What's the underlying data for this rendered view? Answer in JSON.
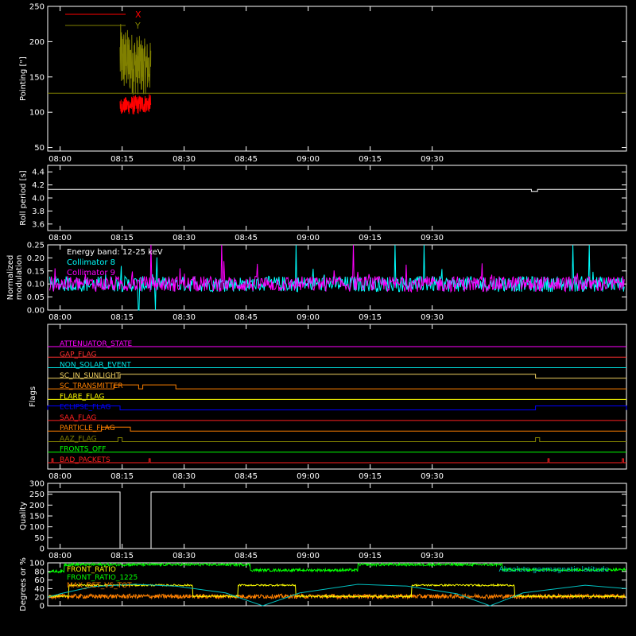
{
  "chart_data": [
    {
      "type": "line",
      "ylabel": "Pointing [\"]",
      "ylim": [
        45,
        250
      ],
      "yticks": [
        50,
        100,
        150,
        200,
        250
      ],
      "xticks": [
        "08:00",
        "08:15",
        "08:30",
        "08:45",
        "09:00",
        "09:15",
        "09:30"
      ],
      "xlim_minutes": [
        -3,
        137
      ],
      "legend": "top-left",
      "series": [
        {
          "name": "X",
          "color": "#ff0000",
          "band": [
            [
              14.5,
              98,
              120
            ],
            [
              18,
              96,
              124
            ],
            [
              22,
              100,
              126
            ]
          ],
          "range_minutes": [
            14.5,
            22
          ]
        },
        {
          "name": "Y",
          "color": "#808000",
          "band": [
            [
              14.5,
              128,
              226
            ],
            [
              18,
              124,
              212
            ],
            [
              22,
              126,
              200
            ]
          ],
          "range_minutes": [
            14.5,
            22
          ]
        }
      ],
      "reference_line": {
        "y": 127,
        "color": "#808000"
      }
    },
    {
      "type": "line",
      "ylabel": "Roll period [s]",
      "ylim": [
        3.5,
        4.5
      ],
      "yticks": [
        "4.4",
        "4.2",
        "4.0",
        "3.8",
        "3.6"
      ],
      "ytick_values": [
        4.4,
        4.2,
        4.0,
        3.8,
        3.6
      ],
      "xticks": [
        "08:00",
        "08:15",
        "08:30",
        "08:45",
        "09:00",
        "09:15",
        "09:30"
      ],
      "series": [
        {
          "name": "",
          "color": "#ffffff",
          "points": [
            [
              -3,
              4.13
            ],
            [
              114,
              4.13
            ],
            [
              114,
              4.1
            ],
            [
              115.5,
              4.1
            ],
            [
              115.5,
              4.13
            ],
            [
              137,
              4.13
            ]
          ]
        }
      ]
    },
    {
      "type": "line",
      "ylabel": "Normalized modulation",
      "ylabel_lines": [
        "Normalized",
        "modulation"
      ],
      "ylim": [
        0,
        0.25
      ],
      "yticks": [
        "0.25",
        "0.20",
        "0.15",
        "0.10",
        "0.05",
        "0.00"
      ],
      "ytick_values": [
        0.25,
        0.2,
        0.15,
        0.1,
        0.05,
        0.0
      ],
      "xticks": [
        "08:00",
        "08:15",
        "08:30",
        "08:45",
        "09:00",
        "09:15",
        "09:30"
      ],
      "annotation": "Energy band: 12-25 keV",
      "series": [
        {
          "name": "Collimator 8",
          "color": "#00ffff",
          "baseline": 0.1,
          "noise": 0.03,
          "spikes": [
            [
              19,
              -0.1
            ],
            [
              23,
              -0.1
            ],
            [
              57,
              0.19
            ],
            [
              81,
              0.17
            ],
            [
              124,
              0.18
            ],
            [
              128,
              0.2
            ],
            [
              88,
              0.17
            ]
          ]
        },
        {
          "name": "Collimator 9",
          "color": "#ff00ff",
          "baseline": 0.1,
          "noise": 0.03,
          "spikes": [
            [
              22,
              0.26
            ],
            [
              39,
              0.25
            ],
            [
              71,
              0.24
            ],
            [
              29,
              0.06
            ],
            [
              30,
              0.04
            ]
          ]
        }
      ]
    },
    {
      "type": "line",
      "ylabel": "Flags",
      "xticks": [
        "08:00",
        "08:15",
        "08:30",
        "08:45",
        "09:00",
        "09:15",
        "09:30"
      ],
      "flags": [
        {
          "name": "ATTENUATOR_STATE",
          "color": "#ff00ff",
          "steps": []
        },
        {
          "name": "GAP_FLAG",
          "color": "#ff3030",
          "steps": []
        },
        {
          "name": "NON_SOLAR_EVENT",
          "color": "#00e0e0",
          "steps": []
        },
        {
          "name": "SC_IN_SUNLIGHT",
          "color": "#f0d060",
          "steps": [
            [
              14.5,
              115
            ]
          ]
        },
        {
          "name": "SC_TRANSMITTER",
          "color": "#ff8000",
          "steps": [
            [
              13,
              19
            ],
            [
              20,
              28
            ]
          ]
        },
        {
          "name": "FLARE_FLAG",
          "color": "#ffff00",
          "steps": []
        },
        {
          "name": "ECLIPSE_FLAG",
          "color": "#0000ff",
          "steps": [
            [
              -3,
              14.5
            ],
            [
              115,
              137
            ]
          ]
        },
        {
          "name": "SAA_FLAG",
          "color": "#ff2020",
          "steps": []
        },
        {
          "name": "PARTICLE_FLAG",
          "color": "#ff8000",
          "steps": [
            [
              10,
              17
            ]
          ]
        },
        {
          "name": "AAZ_FLAG",
          "color": "#808000",
          "steps": [
            [
              14,
              15
            ],
            [
              115,
              116
            ]
          ]
        },
        {
          "name": "FRONTS_OFF",
          "color": "#00ff00",
          "steps": []
        },
        {
          "name": "BAD_PACKETS",
          "color": "#ff2020",
          "steps": [
            [
              -2,
              -1.7
            ],
            [
              21.5,
              21.8
            ],
            [
              118,
              118.3
            ],
            [
              136,
              136.3
            ]
          ]
        }
      ]
    },
    {
      "type": "line",
      "ylabel": "Quality",
      "ylim": [
        0,
        300
      ],
      "yticks": [
        "300",
        "250",
        "200",
        "150",
        "100",
        "50",
        "0"
      ],
      "ytick_values": [
        300,
        250,
        200,
        150,
        100,
        50,
        0
      ],
      "xticks": [
        "08:00",
        "08:15",
        "08:30",
        "08:45",
        "09:00",
        "09:15",
        "09:30"
      ],
      "series": [
        {
          "name": "",
          "color": "#ffffff",
          "points": [
            [
              -3,
              260
            ],
            [
              14.5,
              260
            ],
            [
              14.5,
              0
            ],
            [
              22,
              0
            ],
            [
              22,
              260
            ],
            [
              137,
              260
            ]
          ]
        }
      ]
    },
    {
      "type": "line",
      "ylabel": "Degrees or %",
      "ylim": [
        0,
        100
      ],
      "yticks": [
        "100",
        "80",
        "60",
        "40",
        "20",
        "0"
      ],
      "ytick_values": [
        100,
        80,
        60,
        40,
        20,
        0
      ],
      "series": [
        {
          "name": "FRONT_RATIO",
          "color": "#ffff00",
          "baseline": 48,
          "noise": 2,
          "segments": [
            [
              2,
              32
            ],
            [
              43,
              57
            ],
            [
              85,
              110
            ]
          ],
          "low": 22
        },
        {
          "name": "FRONT_RATIO_1225",
          "color": "#00ff00",
          "baseline": 96,
          "noise": 3,
          "dips": [
            [
              46,
              72,
              83
            ],
            [
              107,
              137,
              84
            ],
            [
              -3,
              1,
              80
            ]
          ]
        },
        {
          "name": "MAX_DET_VS_TOT",
          "color": "#ff8000",
          "baseline": 22,
          "noise": 5
        },
        {
          "name": "Absolute geomagnetic latitude",
          "color": "#00c0c0",
          "legend_position": "top-right",
          "points": [
            [
              -3,
              20
            ],
            [
              0,
              28
            ],
            [
              8,
              45
            ],
            [
              18,
              50
            ],
            [
              28,
              46
            ],
            [
              40,
              30
            ],
            [
              49,
              0
            ],
            [
              58,
              30
            ],
            [
              72,
              50
            ],
            [
              84,
              46
            ],
            [
              96,
              28
            ],
            [
              104,
              0
            ],
            [
              112,
              30
            ],
            [
              127,
              48
            ],
            [
              137,
              40
            ]
          ]
        }
      ]
    }
  ]
}
